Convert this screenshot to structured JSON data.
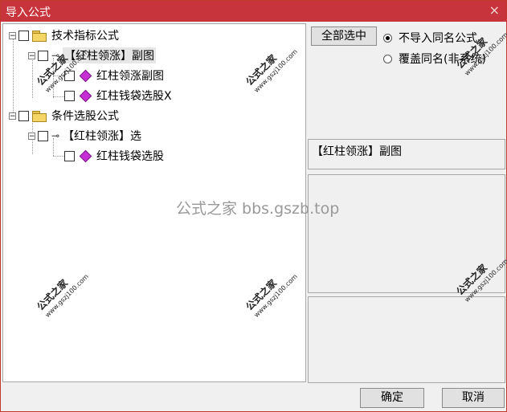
{
  "window": {
    "title": "导入公式",
    "close_icon": "×"
  },
  "tree": {
    "nodes": [
      {
        "label": "技术指标公式",
        "expander": "−"
      },
      {
        "label": "【红柱领涨】副图",
        "expander": "−"
      },
      {
        "label": "红柱领涨副图"
      },
      {
        "label": "红柱钱袋选股X"
      },
      {
        "label": "条件选股公式",
        "expander": "−"
      },
      {
        "label": "【红柱领涨】选",
        "expander": "−",
        "icon": "⊸"
      },
      {
        "label": "红柱钱袋选股"
      }
    ]
  },
  "controls": {
    "select_all": "全部选中",
    "radio_no_import": "不导入同名公式",
    "radio_overwrite": "覆盖同名(非系统)",
    "selected_formula": "【红柱领涨】副图",
    "ok": "确定",
    "cancel": "取消"
  },
  "watermarks": {
    "center": "公式之家 bbs.gszb.top",
    "stamp_title": "公式之家",
    "stamp_url": "www.gszj100.com"
  }
}
